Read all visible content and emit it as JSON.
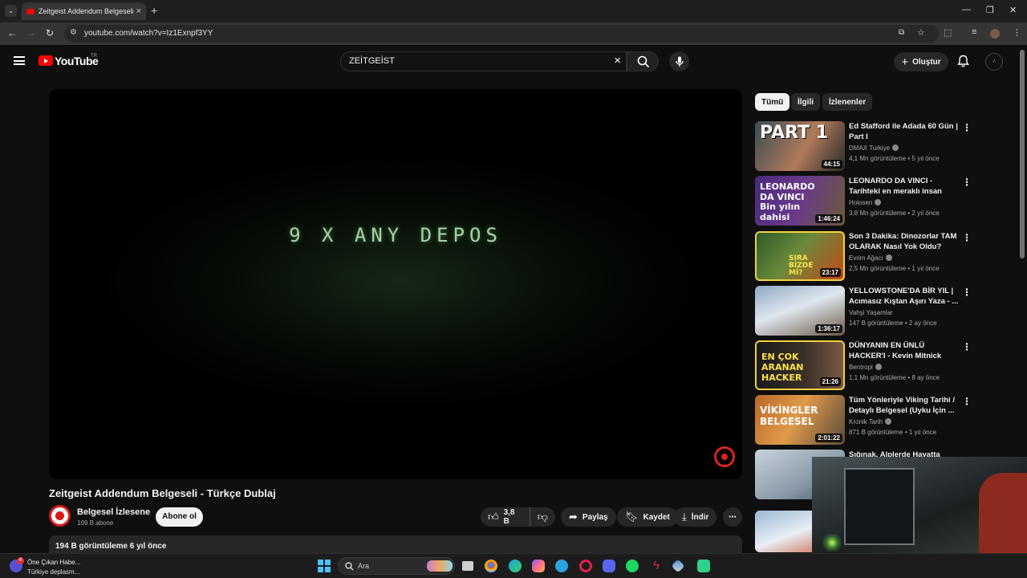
{
  "browser": {
    "tab_title": "Zeitgeist Addendum Belgeseli -",
    "url": "youtube.com/watch?v=Iz1Exnpf3YY"
  },
  "header": {
    "logo": "YouTube",
    "region": "TR",
    "search_value": "ZEİTGEİST",
    "create_label": "Oluştur"
  },
  "player": {
    "overlay_text": "9 X ANY DEPOS"
  },
  "video": {
    "title": "Zeitgeist Addendum Belgeseli - Türkçe Dublaj",
    "channel": "Belgesel İzlesene",
    "subscribers": "109 B abone",
    "subscribe_label": "Abone ol",
    "likes": "3,8 B",
    "share_label": "Paylaş",
    "save_label": "Kaydet",
    "download_label": "İndir",
    "description_meta": "194 B görüntüleme  6 yıl önce"
  },
  "chips": [
    {
      "label": "Tümü"
    },
    {
      "label": "İlgili"
    },
    {
      "label": "İzlenenler"
    }
  ],
  "recommendations": [
    {
      "title": "Ed Stafford ile Adada 60 Gün | Part I",
      "channel": "DMAX Turkiye",
      "meta": "4,1 Mn görüntüleme • 5 yıl önce",
      "duration": "44:15",
      "thumb_text": "PART 1"
    },
    {
      "title": "LEONARDO DA VINCI - Tarihteki en meraklı insan (Biyografi ...",
      "channel": "Holosen",
      "meta": "3,8 Mn görüntüleme • 2 yıl önce",
      "duration": "1:46:24",
      "thumb_text": "LEONARDO DA VINCI Bin yılın dahisi"
    },
    {
      "title": "Son 3 Dakika: Dinozorlar TAM OLARAK Nasıl Yok Oldu?",
      "channel": "Evrim Ağacı",
      "meta": "2,5 Mn görüntüleme • 1 yıl önce",
      "duration": "23:17",
      "thumb_text": "SIRA BİZDE Mİ?"
    },
    {
      "title": "YELLOWSTONE'DA BİR YIL | Acımasız Kıştan Aşırı Yaza - ...",
      "channel": "Vahşi Yaşamlar",
      "meta": "147 B görüntüleme • 2 ay önce",
      "duration": "1:36:17",
      "thumb_text": ""
    },
    {
      "title": "DÜNYANIN EN ÜNLÜ HACKER'I - Kevin Mitnick",
      "channel": "Bentropi",
      "meta": "1,1 Mn görüntüleme • 8 ay önce",
      "duration": "21:26",
      "thumb_text": "EN ÇOK ARANAN HACKER"
    },
    {
      "title": "Tüm Yönleriyle Viking Tarihi / Detaylı Belgesel (Uyku İçin ...",
      "channel": "Kronik Tarih",
      "meta": "871 B görüntüleme • 1 yıl önce",
      "duration": "2:01:22",
      "thumb_text": "VİKİNGLER BELGESEL"
    },
    {
      "title": "Sığınak, Alplerde Hayatta Kalma",
      "channel": "",
      "meta": "",
      "duration": "",
      "thumb_text": ""
    }
  ],
  "taskbar": {
    "news_title": "Öne Çıkan Habe...",
    "news_sub": "Türkiye deplasm...",
    "news_badge": "4",
    "search_label": "Ara"
  }
}
